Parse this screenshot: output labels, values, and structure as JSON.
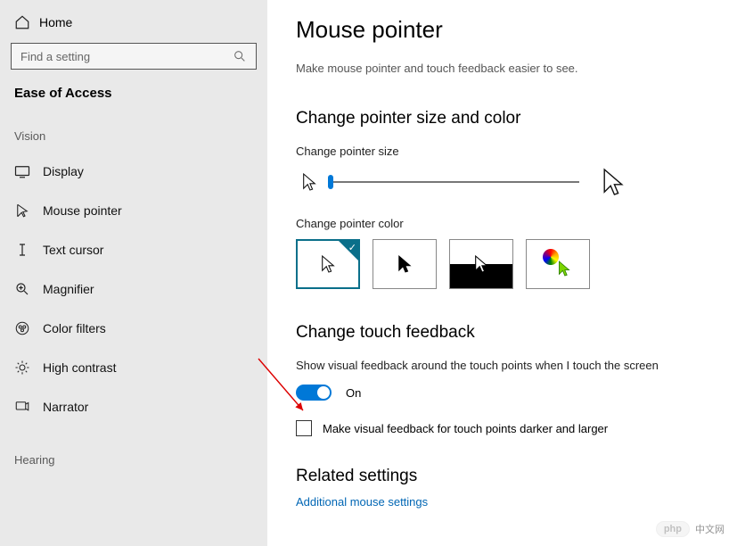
{
  "sidebar": {
    "home": "Home",
    "search_placeholder": "Find a setting",
    "app_title": "Ease of Access",
    "cat_vision": "Vision",
    "cat_hearing": "Hearing",
    "items": [
      {
        "label": "Display"
      },
      {
        "label": "Mouse pointer"
      },
      {
        "label": "Text cursor"
      },
      {
        "label": "Magnifier"
      },
      {
        "label": "Color filters"
      },
      {
        "label": "High contrast"
      },
      {
        "label": "Narrator"
      }
    ]
  },
  "main": {
    "title": "Mouse pointer",
    "subtitle": "Make mouse pointer and touch feedback easier to see.",
    "section_size_color": "Change pointer size and color",
    "change_size_label": "Change pointer size",
    "change_color_label": "Change pointer color",
    "section_touch": "Change touch feedback",
    "touch_desc": "Show visual feedback around the touch points when I touch the screen",
    "toggle_state": "On",
    "check_label": "Make visual feedback for touch points darker and larger",
    "section_related": "Related settings",
    "link_additional": "Additional mouse settings"
  },
  "watermark": {
    "badge": "php",
    "text": "中文网"
  }
}
